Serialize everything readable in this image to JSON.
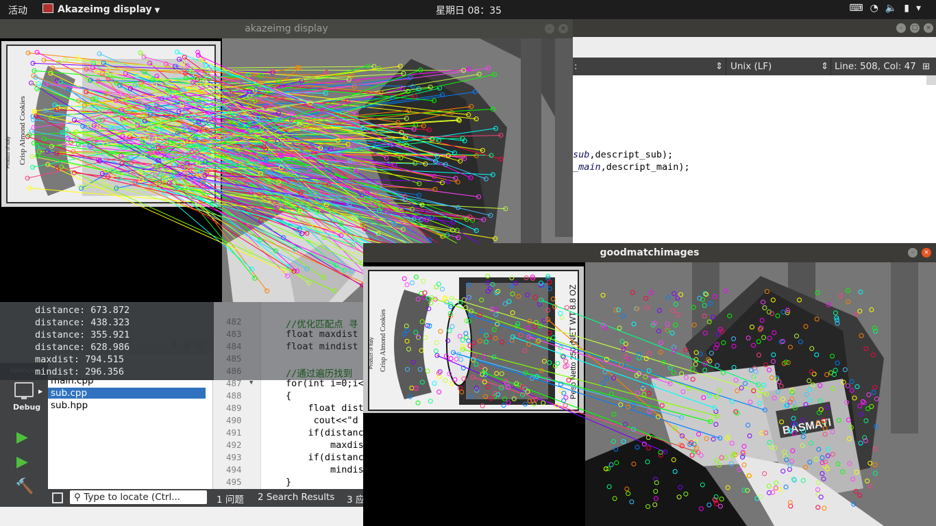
{
  "topbar": {
    "activities": "活动",
    "app_name": "Akazeimg display",
    "clock": "星期日 08：35",
    "tray_icons": [
      "keyboard-icon",
      "wifi-icon",
      "volume-icon",
      "battery-icon",
      "power-menu-icon"
    ]
  },
  "editor_toolbar": {
    "line_ending": "Unix (LF)",
    "position": "Line: 508, Col: 47"
  },
  "code_right": {
    "line1_a": "sub",
    "line1_b": ",descript_sub);",
    "line2_a": "_main",
    "line2_b": ",descript_main);"
  },
  "code_bottom": {
    "line_numbers": [
      "482",
      "483",
      "484",
      "485",
      "486",
      "487",
      "488",
      "489",
      "490",
      "491",
      "492",
      "493",
      "494",
      "495"
    ],
    "lines": [
      "//优化匹配点 寻",
      "float maxdist",
      "float mindist",
      "",
      "//通过遍历找到",
      "for(int i=0;i<",
      "{",
      "    float dist",
      "     cout<<\"d",
      "    if(distanc",
      "        maxdis",
      "    if(distanc",
      "        mindis",
      "}"
    ]
  },
  "console": {
    "lines": [
      "distance: 673.872",
      "distance: 438.323",
      "distance: 355.921",
      "distance: 628.986",
      "maxdist: 794.515",
      "mindist: 296.356"
    ]
  },
  "projects": {
    "header_file": "main.cpp",
    "files": [
      "sub.cpp",
      "sub.hpp"
    ],
    "selected": "sub.cpp"
  },
  "modebar": {
    "project": "opencv",
    "mode": "Debug"
  },
  "output_bar": {
    "locator_placeholder": "Type to locate (Ctrl...",
    "tabs": [
      "1  问题",
      "2  Search Results",
      "3  应"
    ]
  },
  "window1": {
    "title": "akazeimg display"
  },
  "window2": {
    "title": "goodmatchimages"
  },
  "colors": {
    "topbar_bg": "#1d1d1d",
    "ubuntu_orange": "#e95420",
    "selection_blue": "#3072c0",
    "run_green": "#4fbf3c"
  },
  "box_text": {
    "cookies_brand": "Crisp Almond Cookies",
    "product_of": "Product of Italy",
    "net_weight": "NET WT 8.8 OZ",
    "peso": "Peso Netto 250 g",
    "rice": "BASMATI"
  }
}
